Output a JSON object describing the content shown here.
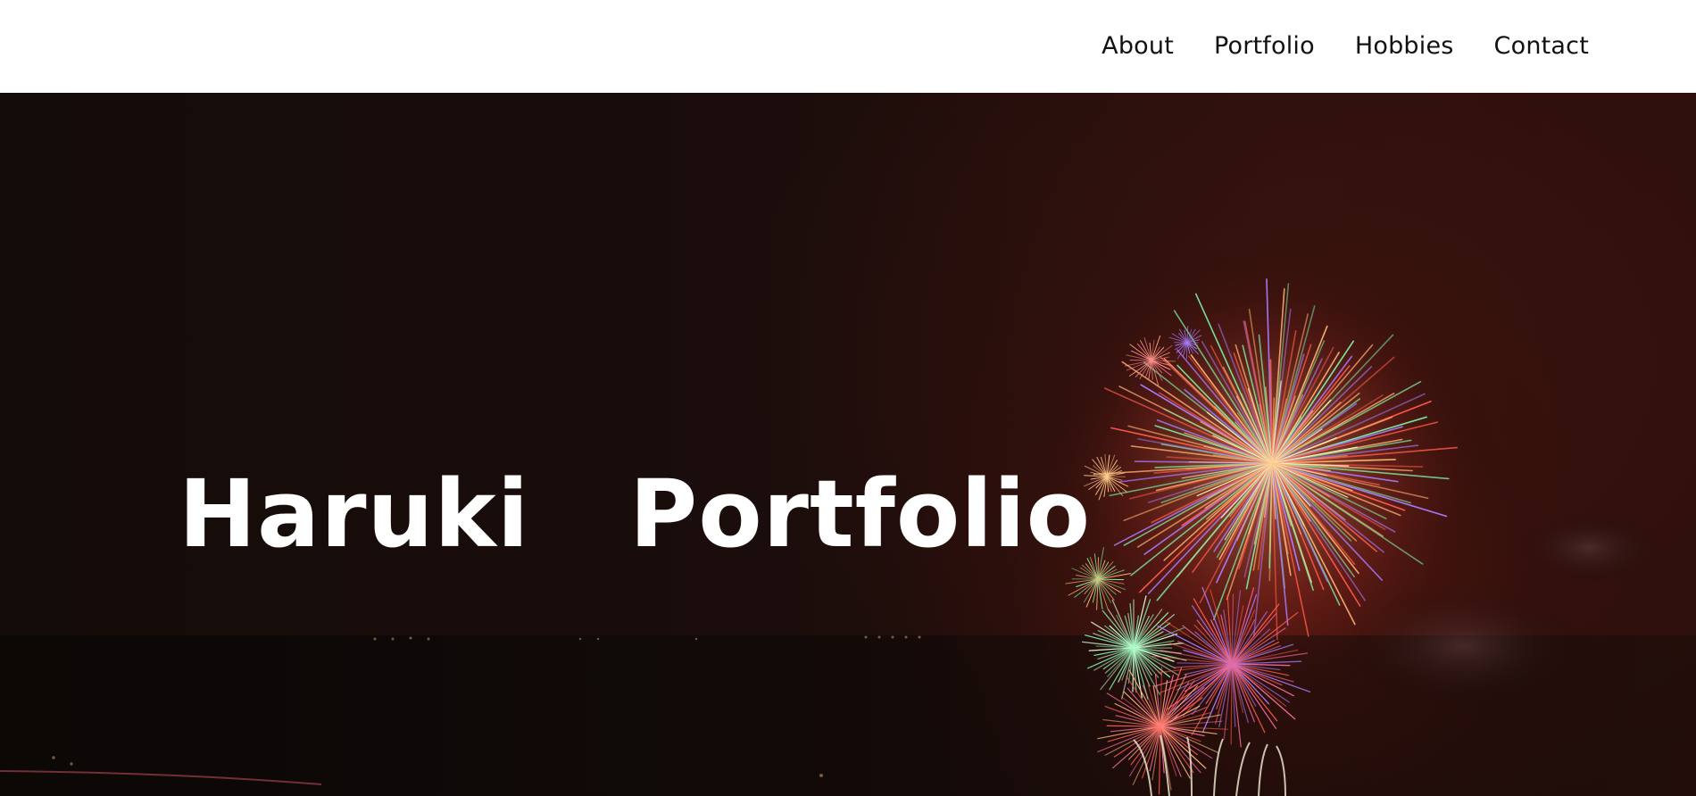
{
  "nav": {
    "items": [
      {
        "label": "About"
      },
      {
        "label": "Portfolio"
      },
      {
        "label": "Hobbies"
      },
      {
        "label": "Contact"
      }
    ]
  },
  "hero": {
    "title": "Haruki   Portfolio",
    "image": {
      "subject": "fireworks-over-bay-at-night",
      "colors": {
        "sky": "#150b09",
        "glow": "#5a1a12",
        "burst_red": "#ff5a4a",
        "burst_orange": "#ffb070",
        "burst_green": "#7df2a8",
        "burst_purple": "#a77cff",
        "burst_pink": "#ff6fa0"
      }
    }
  }
}
